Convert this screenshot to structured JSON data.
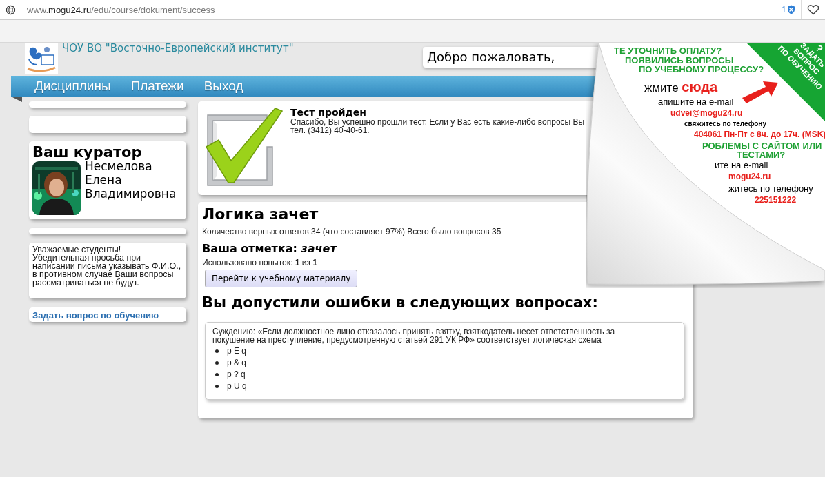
{
  "browser": {
    "url": "www.**mogu24.ru**/edu/course/dokument/success",
    "badge_count": "1"
  },
  "header": {
    "institute": "ЧОУ ВО \"Восточно-Европейский институт\"",
    "welcome": "Добро пожаловать,"
  },
  "nav": [
    {
      "label": "Дисциплины"
    },
    {
      "label": "Платежи"
    },
    {
      "label": "Выход"
    }
  ],
  "curator": {
    "title": "Ваш куратор",
    "name_lines": [
      "Несмелова",
      "Елена",
      "Владимировна"
    ]
  },
  "notice": "Уважаемые студенты!\nУбедительная просьба при написании письма указывать Ф.И.О., в противном случае Ваши вопросы рассматриваться не будут.",
  "ask_link": "Задать вопрос по обучению",
  "test_result": {
    "title": "Тест пройден",
    "lines": [
      "Спасибо, Вы успешно прошли тест. Если у Вас есть какие-либо вопросы Вы",
      "тел. (3412) 40-40-61."
    ]
  },
  "summary": {
    "title": "Логика зачет",
    "stats": "Количество верных ответов 34 (что составляет 97%) Всего было вопросов 35",
    "grade": "Ваша отметка: *зачет*",
    "attempts": "Использовано попыток: **1** из **1**",
    "button": "Перейти к учебному материалу"
  },
  "mistakes": {
    "title": "Вы допустили ошибки в следующих вопросах:",
    "questions": [
      {
        "text": "Суждению: «Если должностное лицо отказалось принять взятку, взяткодатель несет ответственность за покушение на преступление, предусмотренную статьей 291 УК РФ» соответствует логическая схема",
        "options": [
          "p E q",
          "p & q",
          "p ? q",
          "p U q"
        ]
      }
    ]
  },
  "ad": {
    "ribbon": [
      "?",
      "ЗАДАТЬ",
      "ВОПРОС",
      "ПО ОБУЧЕНИЮ"
    ],
    "lines": [
      {
        "kind": "heading",
        "text": "ТЕ УТОЧНИТЬ ОПЛАТУ?"
      },
      {
        "kind": "heading",
        "text": "ПОЯВИЛИСЬ ВОПРОСЫ"
      },
      {
        "kind": "heading",
        "text": "ПО УЧЕБНОМУ ПРОЦЕССУ?"
      },
      {
        "kind": "call",
        "text": "жмите **сюда**"
      },
      {
        "kind": "text",
        "text": "апишите на e-mail"
      },
      {
        "kind": "accent",
        "text": "udvei@mogu24.ru"
      },
      {
        "kind": "small",
        "text": "свяжитесь по телефону"
      },
      {
        "kind": "accent",
        "text": "404061 Пн-Пт с 8ч. до 17ч. (MSK)"
      },
      {
        "kind": "heading",
        "text": "РОБЛЕМЫ С САЙТОМ ИЛИ"
      },
      {
        "kind": "heading",
        "text": "ТЕСТАМИ?"
      },
      {
        "kind": "text",
        "text": "ите на e-mail"
      },
      {
        "kind": "accent",
        "text": "mogu24.ru"
      },
      {
        "kind": "text",
        "text": "житесь по телефону"
      },
      {
        "kind": "accent",
        "text": "225151222"
      }
    ]
  }
}
